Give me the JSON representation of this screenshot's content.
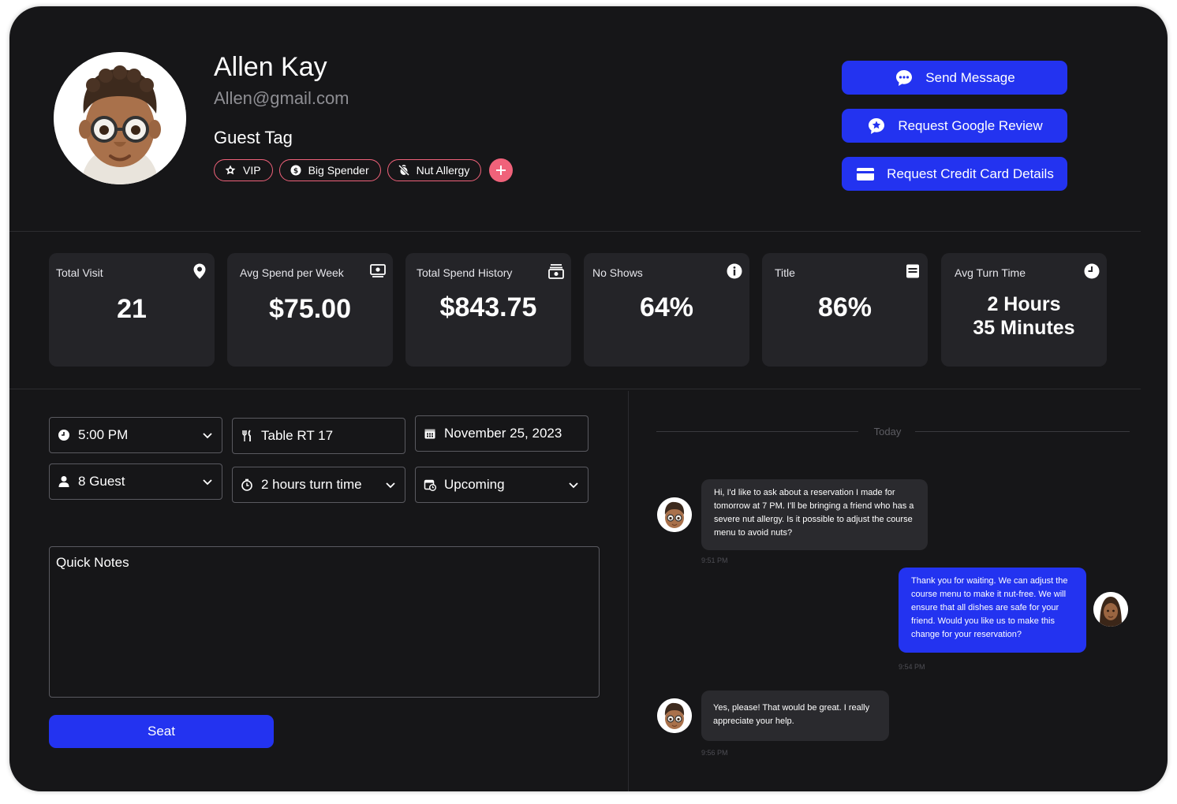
{
  "profile": {
    "name": "Allen Kay",
    "email": "Allen@gmail.com",
    "guest_tag_heading": "Guest Tag",
    "tags": [
      {
        "label": "VIP",
        "icon": "star-badge-icon"
      },
      {
        "label": "Big Spender",
        "icon": "coin-icon"
      },
      {
        "label": "Nut Allergy",
        "icon": "no-nut-icon"
      }
    ],
    "add_tag_icon": "plus-icon"
  },
  "actions": [
    {
      "label": "Send Message",
      "icon": "chat-bubble-icon"
    },
    {
      "label": "Request Google Review",
      "icon": "star-bubble-icon"
    },
    {
      "label": "Request Credit Card Details",
      "icon": "credit-card-icon"
    }
  ],
  "stats": [
    {
      "label": "Total Visit",
      "value": "21",
      "icon": "location-pin-icon"
    },
    {
      "label": "Avg Spend per Week",
      "value": "$75.00",
      "icon": "cash-icon"
    },
    {
      "label": "Total Spend History",
      "value": "$843.75",
      "icon": "wallet-icon"
    },
    {
      "label": "No Shows",
      "value": "64%",
      "icon": "info-icon"
    },
    {
      "label": "Title",
      "value": "86%",
      "icon": "document-icon"
    },
    {
      "label": "Avg Turn Time",
      "value_line1": "2 Hours",
      "value_line2": "35 Minutes",
      "icon": "clock-icon"
    }
  ],
  "form": {
    "time": "5:00 PM",
    "table": "Table RT 17",
    "date": "November 25, 2023",
    "guests": "8 Guest",
    "turn_time": "2 hours turn time",
    "status": "Upcoming",
    "notes_label": "Quick Notes",
    "seat_label": "Seat"
  },
  "chat": {
    "day_label": "Today",
    "messages": [
      {
        "from": "guest",
        "text": "Hi, I'd like to ask about a reservation I made for tomorrow at 7 PM. I'll be bringing a friend who has a severe nut allergy. Is it possible to adjust the course menu to avoid nuts?",
        "time": "9:51 PM"
      },
      {
        "from": "staff",
        "text": "Thank you for waiting. We can adjust the course menu to make it nut-free. We will ensure that all dishes are safe for your friend. Would you like us to make this change for your reservation?",
        "time": "9:54 PM"
      },
      {
        "from": "guest",
        "text": "Yes, please! That would be great. I really appreciate your help.",
        "time": "9:56 PM"
      }
    ]
  },
  "colors": {
    "background": "#161618",
    "card": "#242428",
    "accent": "#2333f0",
    "tag_border": "#f0627a",
    "muted_text": "#8e8e93"
  }
}
